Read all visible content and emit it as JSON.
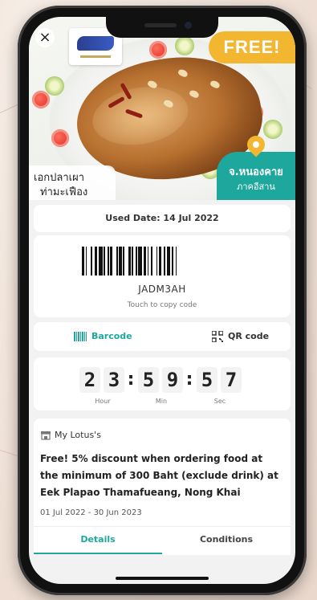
{
  "hero": {
    "free_badge": "FREE!",
    "restaurant_name_line1": "เอกปลาเผา",
    "restaurant_name_line2": "ท่ามะเฟือง",
    "province": "จ.หนองคาย",
    "region": "ภาคอีสาน"
  },
  "used_date": "Used Date: 14 Jul 2022",
  "code": {
    "value": "JADM3AH",
    "hint": "Touch to copy code"
  },
  "tabs": {
    "barcode": "Barcode",
    "qr": "QR code"
  },
  "timer": {
    "digits": [
      "2",
      "3",
      "5",
      "9",
      "5",
      "7"
    ],
    "labels": [
      "Hour",
      "Min",
      "Sec"
    ]
  },
  "merchant": "My Lotus's",
  "description": "Free! 5% discount when ordering food at the minimum of 300 Baht (exclude drink) at Eek Plapao Thamafueang, Nong Khai",
  "period": "01 Jul 2022 - 30 Jun 2023",
  "bottom_tabs": {
    "details": "Details",
    "conditions": "Conditions"
  },
  "colors": {
    "accent": "#1ea79d",
    "badge": "#f2b630"
  }
}
